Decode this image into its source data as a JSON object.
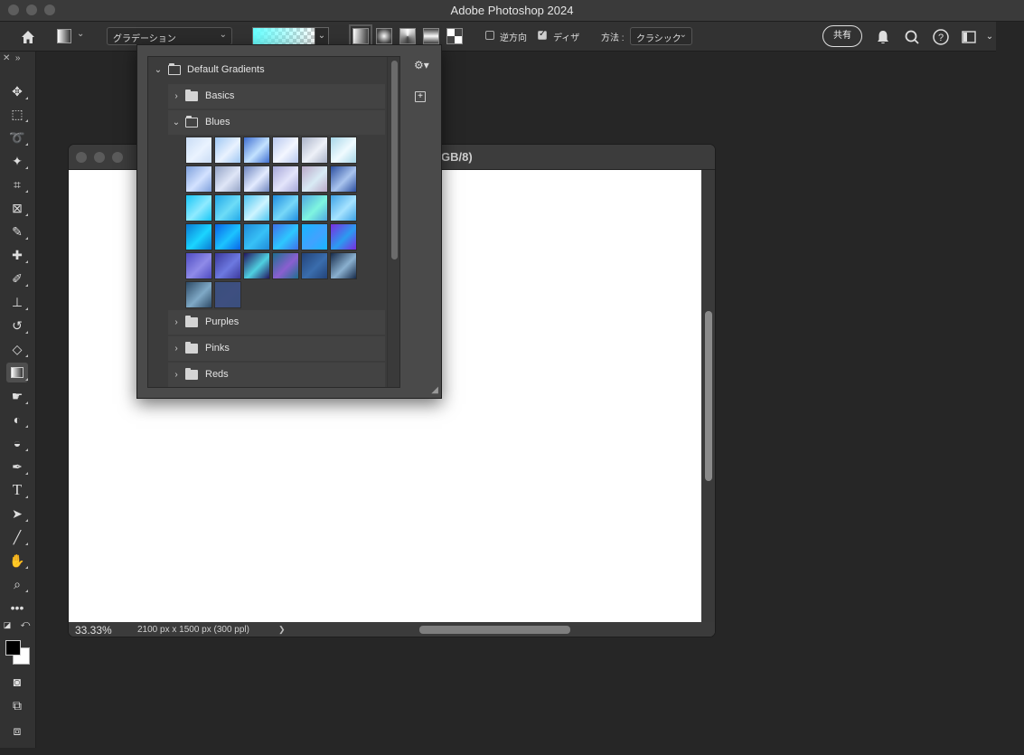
{
  "app": {
    "title": "Adobe Photoshop 2024"
  },
  "options_bar": {
    "gradient_preset_dropdown": "グラデーション",
    "reverse_label": "逆方向",
    "reverse_checked": false,
    "dither_label": "ディザ",
    "dither_checked": true,
    "method_label": "方法 :",
    "method_value": "クラシック",
    "share_label": "共有",
    "gradient_types": [
      "linear",
      "radial",
      "angle",
      "reflected",
      "diamond"
    ],
    "active_gradient_type": "linear"
  },
  "toolbar": {
    "tools": [
      "move",
      "marquee",
      "lasso",
      "magic-wand",
      "crop",
      "frame",
      "eyedropper",
      "healing",
      "brush",
      "stamp",
      "history-brush",
      "eraser",
      "gradient",
      "smudge",
      "dodge",
      "sponge",
      "pen",
      "type",
      "path-select",
      "line",
      "hand",
      "zoom",
      "more"
    ],
    "active_tool": "gradient",
    "foreground_color": "#000000",
    "background_color": "#ffffff"
  },
  "document": {
    "title_visible": "GB/8)",
    "zoom": "33.33%",
    "info": "2100 px x 1500 px (300 ppl)",
    "status_arrow": "❯"
  },
  "gradient_picker": {
    "root_folder": "Default Gradients",
    "folders": [
      {
        "label": "Basics",
        "expanded": false
      },
      {
        "label": "Blues",
        "expanded": true
      },
      {
        "label": "Purples",
        "expanded": false
      },
      {
        "label": "Pinks",
        "expanded": false
      },
      {
        "label": "Reds",
        "expanded": false
      }
    ],
    "blues_swatches": [
      [
        "#c9dcf5",
        "#eaf3ff"
      ],
      [
        "#9ec7f2",
        "#e9f2ff"
      ],
      [
        "#3f6fd1",
        "#c3e2ff"
      ],
      [
        "#b8c8ee",
        "#f3f6ff"
      ],
      [
        "#aab3c9",
        "#eef1f8"
      ],
      [
        "#a7d6e8",
        "#f0fbff"
      ],
      [
        "#7ea0dc",
        "#d3e2ff"
      ],
      [
        "#94a4c7",
        "#dfe6f7"
      ],
      [
        "#6f86bf",
        "#e3ebff"
      ],
      [
        "#a5a7d8",
        "#e4e5fb"
      ],
      [
        "#b9a8c8",
        "#d9ebf5"
      ],
      [
        "#2c4fa0",
        "#a9c4ee"
      ],
      [
        "#17c6f6",
        "#8feaff"
      ],
      [
        "#20a8e8",
        "#6ddcf7"
      ],
      [
        "#4cc4f0",
        "#cdf4ff"
      ],
      [
        "#1f8de0",
        "#77d8f8"
      ],
      [
        "#4ea7e0",
        "#7ff5e0"
      ],
      [
        "#3ea2e6",
        "#a6e3ff"
      ],
      [
        "#0a7ad3",
        "#1bd4ff"
      ],
      [
        "#0a63e6",
        "#1cc3ff"
      ],
      [
        "#1f8ad8",
        "#37c1f7"
      ],
      [
        "#3f6fe8",
        "#2ec7ff"
      ],
      [
        "#16b6ff",
        "#41a2ff"
      ],
      [
        "#7a2ce0",
        "#2b9cf0"
      ],
      [
        "#4f4cc1",
        "#8f8be8"
      ],
      [
        "#3c3a9e",
        "#6d79e0"
      ],
      [
        "#23155f",
        "#4fd0e0"
      ],
      [
        "#1f6f8f",
        "#8a5fd0"
      ],
      [
        "#23437a",
        "#3a6dad"
      ],
      [
        "#172b4a",
        "#8ab0cf"
      ],
      [
        "#2d4a66",
        "#7fa9c6"
      ],
      [
        "#3a4f7d",
        "#3e4f80"
      ]
    ]
  }
}
